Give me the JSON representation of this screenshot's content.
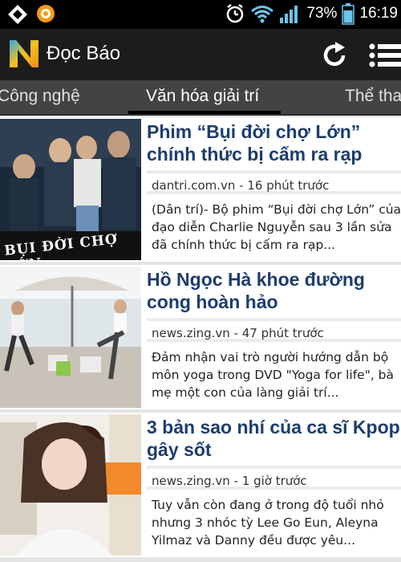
{
  "status_bar": {
    "battery_percent": "73%",
    "time": "16:19",
    "icons": [
      "notification-icon",
      "browser-icon",
      "alarm-icon",
      "wifi-icon",
      "signal-icon",
      "battery-icon"
    ]
  },
  "app_bar": {
    "title": "Đọc Báo",
    "logo_letter": "N",
    "actions": [
      "refresh-icon",
      "menu-icon"
    ]
  },
  "tabs": [
    {
      "label": "Công nghệ"
    },
    {
      "label": "Văn hóa giải trí",
      "active": true
    },
    {
      "label": "Thể thao"
    }
  ],
  "articles": [
    {
      "headline": "Phim “Bụi đời chợ Lớn” chính thức bị cấm ra rạp",
      "source": "dantri.com.vn - 16 phút trước",
      "summary": "(Dân trí)- Bộ phim “Bụi đời chợ Lớn” của đạo diễn Charlie Nguyễn sau 3 lần sửa đã chính thức bị cấm ra rạp...",
      "poster_text": "BỤI ĐỜI CHỢ LỚN"
    },
    {
      "headline": "Hồ Ngọc Hà khoe đường cong hoàn hảo",
      "source": "news.zing.vn - 47 phút trước",
      "summary": "Đảm nhận vai trò người hướng dẫn bộ môn yoga trong DVD \"Yoga for life\", bà mẹ một con của làng giải trí..."
    },
    {
      "headline": "3 bản sao nhí của ca sĩ Kpop gây sốt",
      "source": "news.zing.vn - 1 giờ trước",
      "summary": "Tuy vẫn còn đang ở trong độ tuổi nhỏ nhưng 3 nhóc tỳ Lee Go Eun, Aleyna Yilmaz và Danny đều được yêu..."
    }
  ],
  "colors": {
    "headline": "#1d3d6e",
    "app_bar": "#1c1c1c",
    "tab_bar": "#434343",
    "battery": "#4fc3f7"
  }
}
